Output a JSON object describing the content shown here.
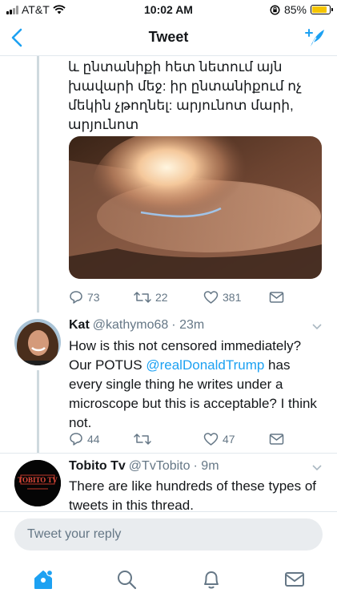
{
  "status_bar": {
    "carrier": "AT&T",
    "time": "10:02 AM",
    "battery": "85%",
    "battery_level": 0.85
  },
  "nav": {
    "title": "Tweet",
    "back_icon": "chevron-left-icon",
    "compose_icon": "compose-tweet-icon"
  },
  "main_tweet": {
    "text": "և ընտանիքի հետ նետում այն խավարի մեջ: իր ընտանիքում ոչ մեկին չթողնել: արյունոտ մարի, արյունոտ",
    "replies": "73",
    "retweets": "22",
    "likes": "381"
  },
  "replies": [
    {
      "name": "Kat",
      "handle": "@kathymo68",
      "time": "· 23m",
      "text_before": "How is this not censored immediately? Our POTUS ",
      "mention": "@realDonaldTrump",
      "text_after": " has every single thing he writes under a microscope but this is acceptable?  I think not.",
      "replies": "44",
      "retweets": "",
      "likes": "47"
    },
    {
      "name": "Tobito Tv",
      "handle": "@TvTobito",
      "time": "· 9m",
      "text": "There are like hundreds of these types of tweets in this thread.",
      "avatar_text": "TOBITO TV"
    }
  ],
  "reply_box": {
    "placeholder": "Tweet your reply"
  },
  "tabbar": [
    "home-icon",
    "search-icon",
    "notifications-icon",
    "messages-icon"
  ],
  "colors": {
    "accent": "#1da1f2",
    "secondary_text": "#657786",
    "divider": "#e1e8ed"
  }
}
